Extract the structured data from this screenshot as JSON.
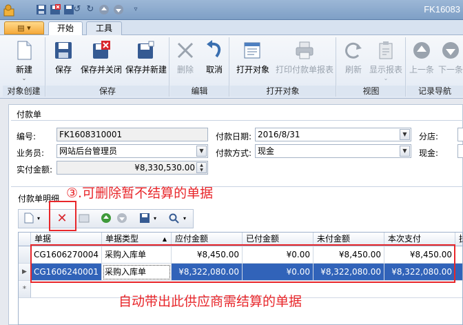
{
  "window": {
    "title": "FK16083"
  },
  "quick_access": [
    "app-icon",
    "save-icon",
    "save-close-icon",
    "undo-icon",
    "redo-icon",
    "up-icon",
    "down-icon",
    "customize-icon"
  ],
  "tabs": {
    "app_menu": "",
    "start": "开始",
    "tools": "工具"
  },
  "ribbon": {
    "new": "新建",
    "save": "保存",
    "save_close": "保存并关闭",
    "save_new": "保存并新建",
    "delete": "删除",
    "cancel": "取消",
    "open_object": "打开对象",
    "print_report": "打印付款单报表",
    "refresh": "刷新",
    "show_report": "显示报表",
    "prev": "上一条",
    "next": "下一条",
    "groups": {
      "object_create": "对象创建",
      "save": "保存",
      "edit": "编辑",
      "open_object": "打开对象",
      "view": "视图",
      "record_nav": "记录导航"
    }
  },
  "form": {
    "title": "付款单",
    "code_label": "编号:",
    "code_value": "FK1608310001",
    "date_label": "付款日期:",
    "date_value": "2016/8/31",
    "branch_label": "分店:",
    "operator_label": "业务员:",
    "operator_value": "网站后台管理员",
    "method_label": "付款方式:",
    "method_value": "现金",
    "cash_label": "现金:",
    "amount_label": "实付金额:",
    "amount_value": "¥8,330,530.00"
  },
  "detail": {
    "label": "付款单明细",
    "columns": [
      "单据",
      "单据类型",
      "应付金额",
      "已付金额",
      "未付金额",
      "本次支付",
      "执"
    ],
    "rows": [
      [
        "CG1606270004",
        "采购入库单",
        "¥8,450.00",
        "¥0.00",
        "¥8,450.00",
        "¥8,450.00"
      ],
      [
        "CG1606240001",
        "采购入库单",
        "¥8,322,080.00",
        "¥0.00",
        "¥8,322,080.00",
        "¥8,322,080.00"
      ]
    ],
    "new_row_marker": "*"
  },
  "annotations": {
    "delete_note": "③.可删除暂不结算的单据",
    "auto_note": "自动带出此供应商需结算的单据"
  },
  "colors": {
    "accent": "#3163b9",
    "annotation": "#e8262a"
  }
}
